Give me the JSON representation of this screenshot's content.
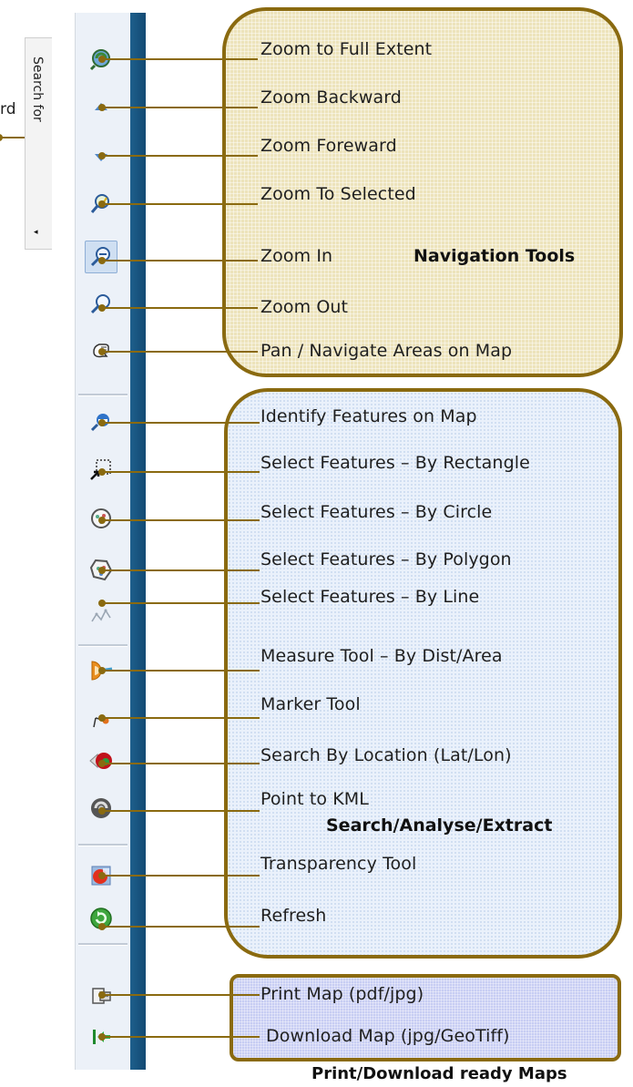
{
  "side_panel": {
    "search_tab_label": "Search for",
    "clipped_text": "rd",
    "collapse_arrow": "◂"
  },
  "groups": {
    "navigation": {
      "title": "Navigation Tools",
      "tools": [
        {
          "icon": "zoom-full-extent-icon",
          "label": "Zoom to Full Extent"
        },
        {
          "icon": "zoom-backward-icon",
          "label": "Zoom Backward"
        },
        {
          "icon": "zoom-forward-icon",
          "label": "Zoom Foreward"
        },
        {
          "icon": "zoom-to-selected-icon",
          "label": "Zoom To Selected"
        },
        {
          "icon": "zoom-in-icon",
          "label": "Zoom In",
          "active": true
        },
        {
          "icon": "zoom-out-icon",
          "label": "Zoom Out"
        },
        {
          "icon": "pan-hand-icon",
          "label": "Pan / Navigate Areas on Map"
        }
      ]
    },
    "search": {
      "title": "Search/Analyse/Extract",
      "tools": [
        {
          "icon": "identify-icon",
          "label": "Identify Features on Map"
        },
        {
          "icon": "select-rectangle-icon",
          "label": "Select Features – By Rectangle"
        },
        {
          "icon": "select-circle-icon",
          "label": "Select Features – By Circle"
        },
        {
          "icon": "select-polygon-icon",
          "label": "Select Features – By Polygon"
        },
        {
          "icon": "select-line-icon",
          "label": "Select Features – By Line"
        },
        {
          "icon": "measure-icon",
          "label": "Measure Tool – By Dist/Area"
        },
        {
          "icon": "marker-icon",
          "label": "Marker Tool"
        },
        {
          "icon": "search-location-icon",
          "label": "Search By Location (Lat/Lon)"
        },
        {
          "icon": "point-to-kml-icon",
          "label": "Point to KML"
        },
        {
          "icon": "transparency-icon",
          "label": "Transparency Tool"
        },
        {
          "icon": "refresh-icon",
          "label": "Refresh"
        }
      ]
    },
    "print": {
      "title": "Print/Download ready Maps",
      "tools": [
        {
          "icon": "print-map-icon",
          "label": "Print Map (pdf/jpg)"
        },
        {
          "icon": "download-map-icon",
          "label": "Download Map (jpg/GeoTiff)"
        }
      ]
    }
  },
  "colors": {
    "leader_line": "#8a6a10",
    "nav_fill": "#ede3bb",
    "search_fill": "#eaf1fb",
    "print_fill": "#c7cdf3",
    "toolbar_strip": "#1e5f8c"
  }
}
